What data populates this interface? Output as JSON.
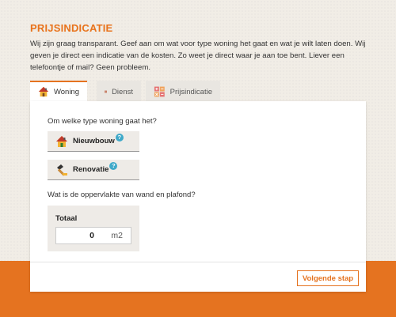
{
  "heading": "PRIJSINDICATIE",
  "intro": "Wij zijn graag transparant. Geef aan om wat voor type woning het gaat en wat je wilt laten doen. Wij geven je direct een indicatie van de kosten. Zo weet je direct waar je aan toe bent. Liever een telefoontje of mail? Geen probleem.",
  "tabs": [
    {
      "label": "Woning",
      "icon": "house-icon",
      "active": true
    },
    {
      "label": "Dienst",
      "icon": "brick-wall-icon",
      "active": false
    },
    {
      "label": "Prijsindicatie",
      "icon": "calculator-icon",
      "active": false
    }
  ],
  "form": {
    "question_type": "Om welke type woning gaat het?",
    "options": [
      {
        "label": "Nieuwbouw",
        "icon": "house-icon",
        "help": "?"
      },
      {
        "label": "Renovatie",
        "icon": "hammer-icon",
        "help": "?"
      }
    ],
    "question_area": "Wat is de oppervlakte van wand en plafond?",
    "area": {
      "label": "Totaal",
      "value": "0",
      "unit": "m2"
    },
    "next_label": "Volgende stap"
  },
  "colors": {
    "accent": "#e57320",
    "help": "#3fa9c9"
  }
}
